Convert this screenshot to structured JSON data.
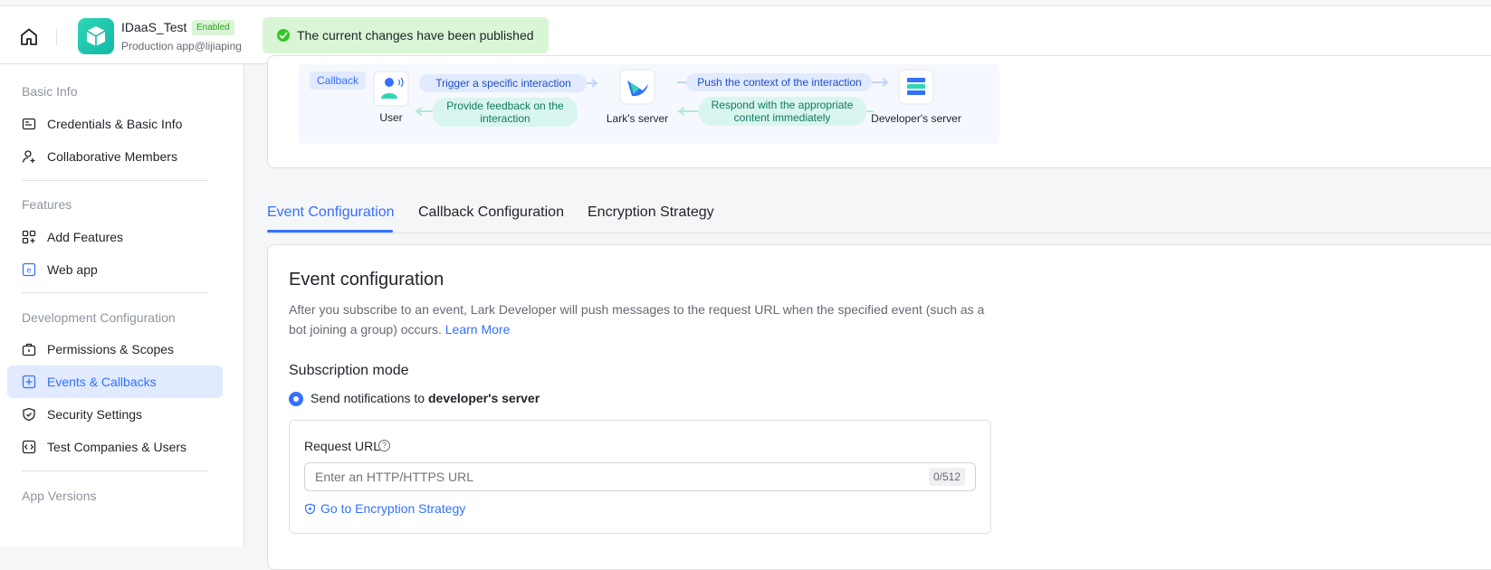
{
  "header": {
    "app_name": "IDaaS_Test",
    "status_badge": "Enabled",
    "app_subtitle": "Production app@lijiaping",
    "toast": "The current changes have been published"
  },
  "sidebar": {
    "sections": [
      {
        "title": "Basic Info"
      },
      {
        "title": "Features"
      },
      {
        "title": "Development Configuration"
      },
      {
        "title": "App Versions"
      }
    ],
    "items": [
      {
        "label": "Credentials & Basic Info",
        "icon": "id-card-icon"
      },
      {
        "label": "Collaborative Members",
        "icon": "add-member-icon"
      },
      {
        "label": "Add Features",
        "icon": "grid-plus-icon"
      },
      {
        "label": "Web app",
        "icon": "web-app-icon"
      },
      {
        "label": "Permissions & Scopes",
        "icon": "briefcase-lock-icon"
      },
      {
        "label": "Events & Callbacks",
        "icon": "events-icon",
        "active": true
      },
      {
        "label": "Security Settings",
        "icon": "shield-check-icon"
      },
      {
        "label": "Test Companies & Users",
        "icon": "code-icon"
      }
    ]
  },
  "diagram": {
    "callback_tag": "Callback",
    "user": "User",
    "lark_server": "Lark's server",
    "dev_server": "Developer's server",
    "arrow1": "Trigger a specific interaction",
    "arrow2_line1": "Provide feedback on the",
    "arrow2_line2": "interaction",
    "arrow3": "Push the context of the interaction",
    "arrow4_line1": "Respond with the appropriate",
    "arrow4_line2": "content immediately"
  },
  "tabs": [
    {
      "label": "Event Configuration",
      "active": true
    },
    {
      "label": "Callback Configuration"
    },
    {
      "label": "Encryption Strategy"
    }
  ],
  "event_config": {
    "title": "Event configuration",
    "description": "After you subscribe to an event, Lark Developer will push messages to the request URL when the specified event (such as a bot joining a group) occurs.",
    "learn_more": "Learn More",
    "subscription_title": "Subscription mode",
    "radio_prefix": "Send notifications to ",
    "radio_bold": "developer's server",
    "request_url_label": "Request URL",
    "request_url_placeholder": "Enter an HTTP/HTTPS URL",
    "request_url_value": "",
    "char_count": "0/512",
    "encryption_link": "Go to Encryption Strategy"
  },
  "colors": {
    "accent": "#3370ff",
    "success": "#34c724",
    "brand": "#12b8a6"
  }
}
